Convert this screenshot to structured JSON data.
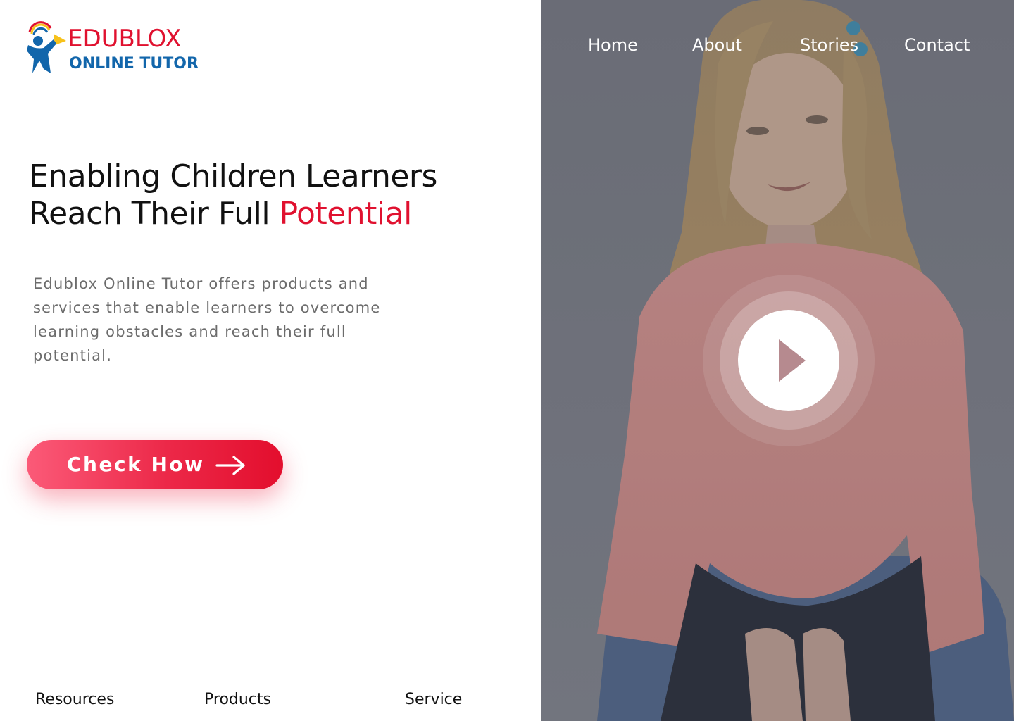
{
  "brand": {
    "name_top": "EDUBLOX",
    "name_bottom": "ONLINE TUTOR",
    "colors": {
      "red": "#e0112f",
      "blue": "#1266ab",
      "yellow": "#f7c21b"
    }
  },
  "nav": {
    "items": [
      {
        "label": "Home"
      },
      {
        "label": "About"
      },
      {
        "label": "Stories"
      },
      {
        "label": "Contact"
      }
    ]
  },
  "hero": {
    "headline_line1": "Enabling Children Learners",
    "headline_line2_prefix": "Reach Their Full ",
    "headline_line2_accent": "Potential",
    "accent_color": "#e0112f",
    "description": "Edublox Online Tutor offers products and services that enable learners to overcome learning obstacles and reach their full potential.",
    "cta_label": "Check How",
    "cta_icon": "arrow-right-icon"
  },
  "video": {
    "play_icon": "play-icon"
  },
  "footer": {
    "links": [
      {
        "label": "Resources"
      },
      {
        "label": "Products"
      },
      {
        "label": "Service"
      }
    ]
  }
}
